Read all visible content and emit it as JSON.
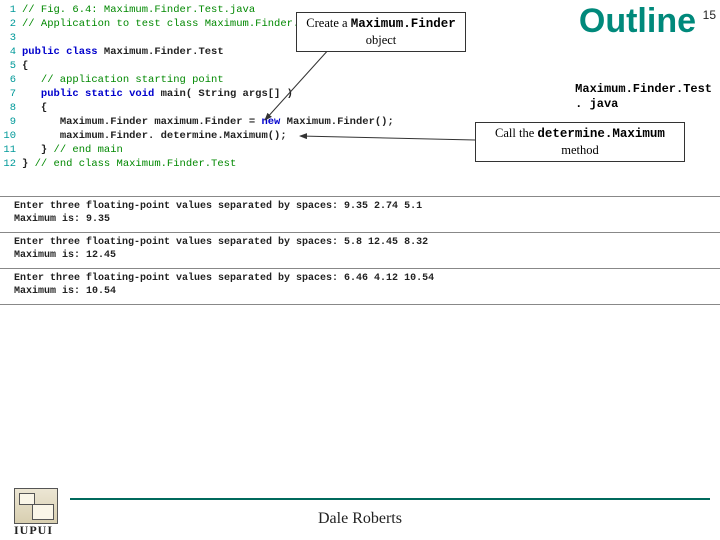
{
  "outline_label": "Outline",
  "slide_number": "15",
  "filename": "Maximum.Finder.Test\n. java",
  "callout1": {
    "line1": "Create a ",
    "mono": "Maximum.Finder",
    "line2": "object"
  },
  "callout2": {
    "line1": "Call the ",
    "mono": "determine.Maximum",
    "line2": "method"
  },
  "code": {
    "l1": {
      "n": "1",
      "a": "// Fig. 6.4: Maximum.Finder.Test.java"
    },
    "l2": {
      "n": "2",
      "a": "// Application to test class Maximum.Finder."
    },
    "l3": {
      "n": "3",
      "a": ""
    },
    "l4": {
      "n": "4",
      "kw": "public class",
      "id": " Maximum.Finder.Test"
    },
    "l5": {
      "n": "5",
      "br": "{"
    },
    "l6": {
      "n": "6",
      "pad": "   ",
      "a": "// application starting point"
    },
    "l7": {
      "n": "7",
      "pad": "   ",
      "kw": "public static void",
      "id": " main( String args[] )"
    },
    "l8": {
      "n": "8",
      "pad": "   ",
      "br": "{"
    },
    "l9": {
      "n": "9",
      "pad": "      ",
      "id1": "Maximum.Finder maximum.Finder = ",
      "kw": "new",
      "id2": " Maximum.Finder();"
    },
    "l10": {
      "n": "10",
      "pad": "      ",
      "id": "maximum.Finder. determine.Maximum();"
    },
    "l11": {
      "n": "11",
      "pad": "   ",
      "br": "}",
      "a": " // end main"
    },
    "l12": {
      "n": "12",
      "br": "}",
      "a": " // end class Maximum.Finder.Test"
    }
  },
  "outputs": [
    "Enter three floating-point values separated by spaces: 9.35 2.74 5.1\nMaximum is: 9.35",
    "Enter three floating-point values separated by spaces: 5.8 12.45 8.32\nMaximum is: 12.45",
    "Enter three floating-point values separated by spaces: 6.46 4.12 10.54\nMaximum is: 10.54"
  ],
  "author": "Dale Roberts",
  "iupui": "IUPUI"
}
